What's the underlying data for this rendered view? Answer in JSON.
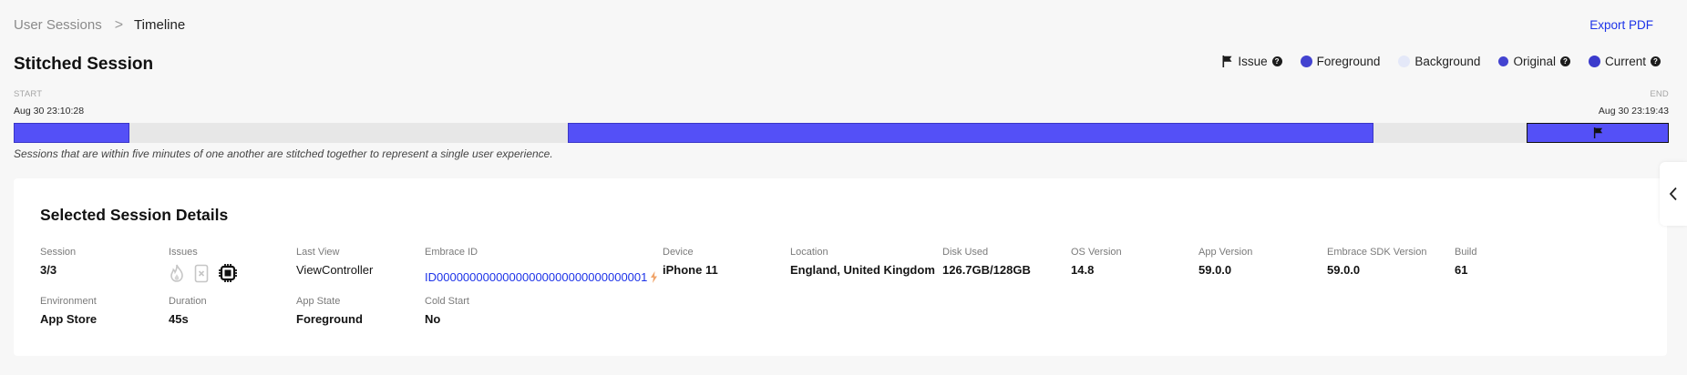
{
  "breadcrumb": {
    "parent": "User Sessions",
    "separator": ">",
    "current": "Timeline"
  },
  "export_label": "Export PDF",
  "page_title": "Stitched Session",
  "legend": {
    "issue": "Issue",
    "foreground": "Foreground",
    "background": "Background",
    "original": "Original",
    "current": "Current",
    "help_glyph": "?"
  },
  "timeline": {
    "start_label": "START",
    "end_label": "END",
    "start_time": "Aug 30 23:10:28",
    "end_time": "Aug 30 23:19:43",
    "note": "Sessions that are within five minutes of one another are stitched together to represent a single user experience."
  },
  "details": {
    "title": "Selected Session Details",
    "session": {
      "label": "Session",
      "value": "3/3"
    },
    "issues": {
      "label": "Issues"
    },
    "last_view": {
      "label": "Last View",
      "value": "ViewController"
    },
    "embrace_id": {
      "label": "Embrace ID",
      "value": "ID00000000000000000000000000000001"
    },
    "device": {
      "label": "Device",
      "value": "iPhone 11"
    },
    "location": {
      "label": "Location",
      "value": "England, United Kingdom"
    },
    "disk_used": {
      "label": "Disk Used",
      "value": "126.7GB/128GB"
    },
    "os_version": {
      "label": "OS Version",
      "value": "14.8"
    },
    "app_version": {
      "label": "App Version",
      "value": "59.0.0"
    },
    "sdk_version": {
      "label": "Embrace SDK Version",
      "value": "59.0.0"
    },
    "build": {
      "label": "Build",
      "value": "61"
    },
    "environment": {
      "label": "Environment",
      "value": "App Store"
    },
    "duration": {
      "label": "Duration",
      "value": "45s"
    },
    "app_state": {
      "label": "App State",
      "value": "Foreground"
    },
    "cold_start": {
      "label": "Cold Start",
      "value": "No"
    }
  },
  "colors": {
    "accent": "#1d33e8",
    "foreground_segment": "#5450f7",
    "background_segment": "#e7e7e7",
    "legend_background": "#e4e8f8"
  },
  "icons": {
    "issue": "flag-icon",
    "issues": [
      "flame-icon",
      "crash-file-icon",
      "cpu-chip-icon"
    ],
    "embrace_id_action": "lightning-icon",
    "side_tab": "chevron-left-icon"
  }
}
